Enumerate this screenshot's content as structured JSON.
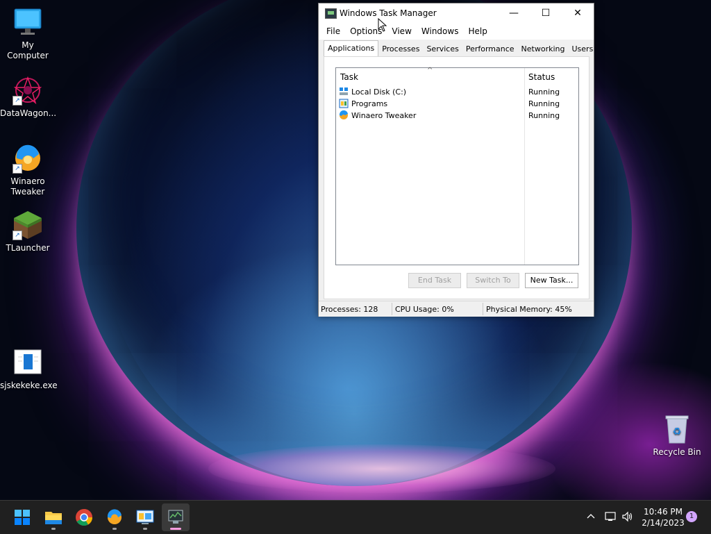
{
  "desktop": {
    "icons": [
      {
        "label": "My Computer",
        "icon": "monitor-icon"
      },
      {
        "label": "DataWagon...",
        "icon": "datawagon-icon"
      },
      {
        "label": "Winaero Tweaker",
        "icon": "winaero-icon"
      },
      {
        "label": "TLauncher",
        "icon": "grass-block-icon"
      },
      {
        "label": "sjskekeke.exe",
        "icon": "exe-icon"
      },
      {
        "label": "Recycle Bin",
        "icon": "recycle-bin-icon"
      }
    ]
  },
  "window": {
    "title": "Windows Task Manager",
    "controls": {
      "minimize": "—",
      "maximize": "☐",
      "close": "✕"
    },
    "menu": [
      "File",
      "Options",
      "View",
      "Windows",
      "Help"
    ],
    "tabs": [
      "Applications",
      "Processes",
      "Services",
      "Performance",
      "Networking",
      "Users"
    ],
    "active_tab": "Applications",
    "columns": {
      "task": "Task",
      "status": "Status"
    },
    "rows": [
      {
        "task": "Local Disk (C:)",
        "status": "Running",
        "icon": "drive-icon"
      },
      {
        "task": "Programs",
        "status": "Running",
        "icon": "programs-icon"
      },
      {
        "task": "Winaero Tweaker",
        "status": "Running",
        "icon": "winaero-icon"
      }
    ],
    "buttons": {
      "end_task": "End Task",
      "switch_to": "Switch To",
      "new_task": "New Task..."
    },
    "statusbar": {
      "processes": "Processes: 128",
      "cpu": "CPU Usage: 0%",
      "memory": "Physical Memory: 45%"
    }
  },
  "taskbar": {
    "apps": [
      "start-icon",
      "file-explorer-icon",
      "chrome-icon",
      "winaero-icon",
      "control-panel-icon",
      "task-manager-icon"
    ],
    "clock": {
      "time": "10:46 PM",
      "date": "2/14/2023"
    },
    "notification_count": "1",
    "tray_icons": [
      "chevron-up-icon",
      "network-icon",
      "volume-icon"
    ]
  },
  "colors": {
    "taskbar": "#202020",
    "accent": "#0078d4",
    "notif_badge": "#d3a6ff"
  }
}
